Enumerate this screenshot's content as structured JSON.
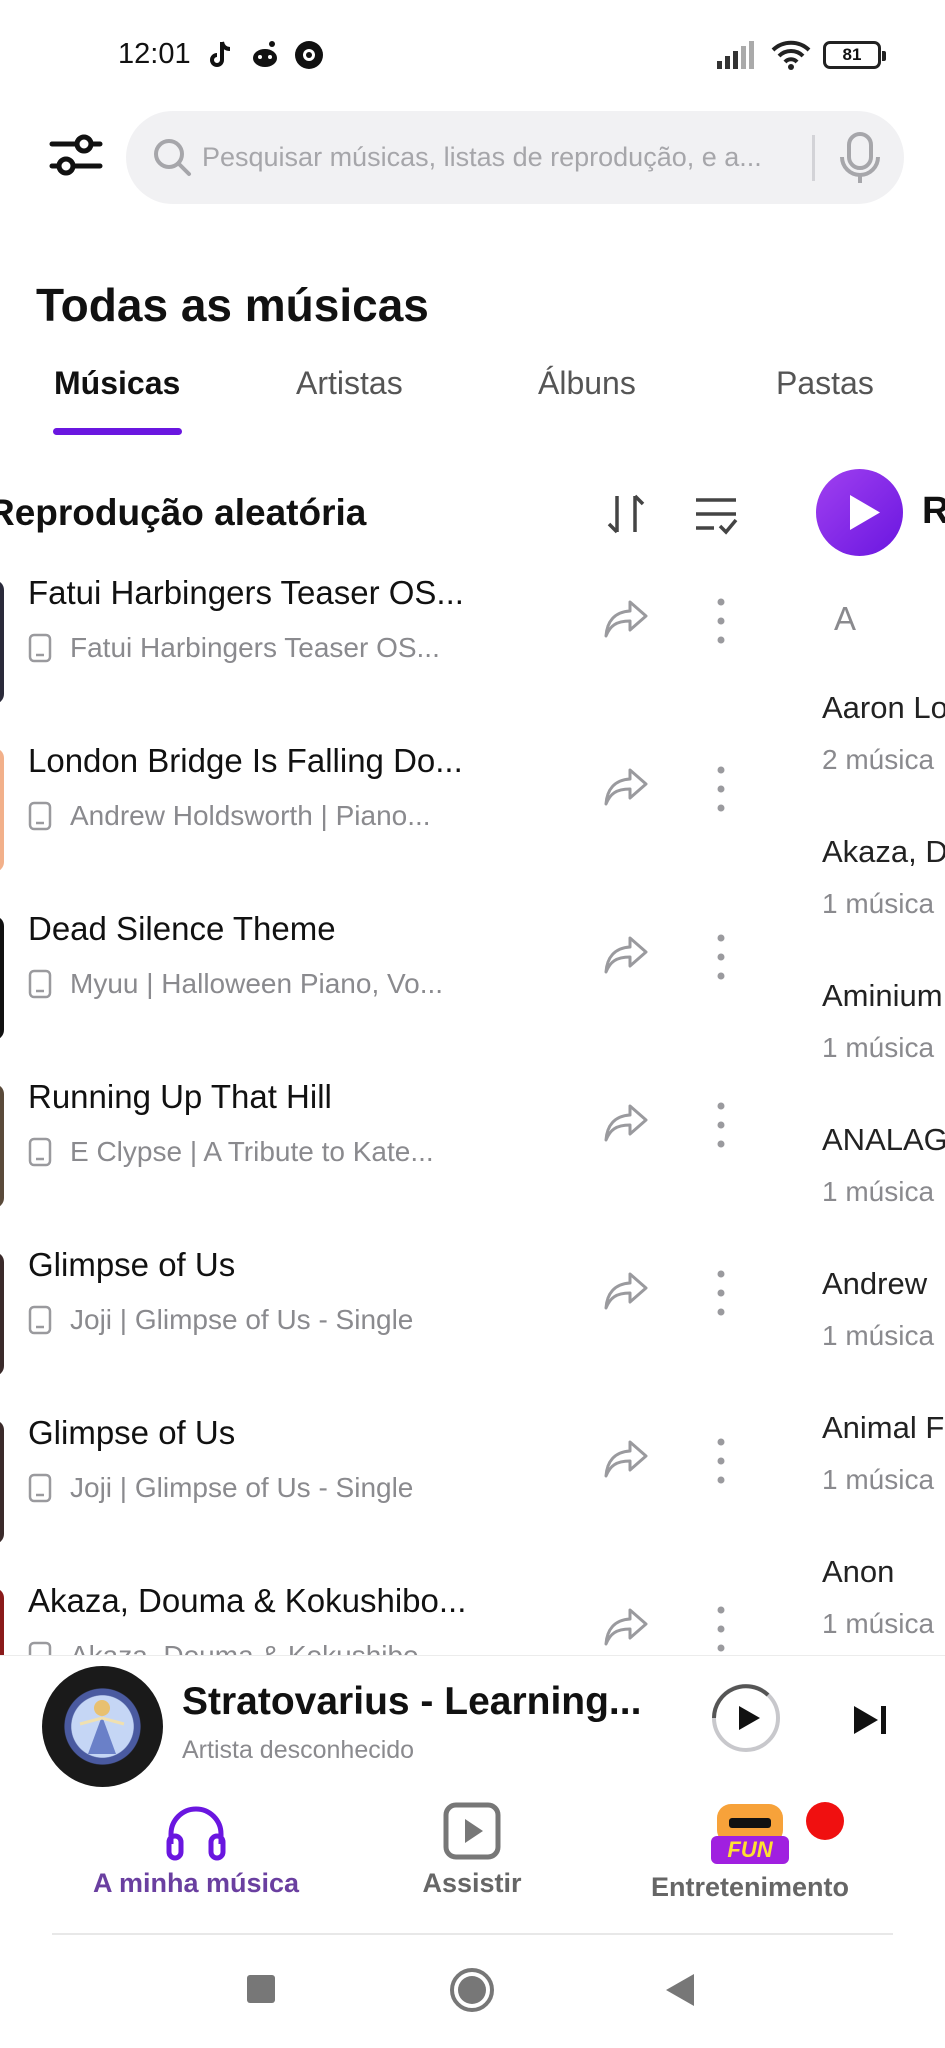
{
  "status_bar": {
    "time": "12:01",
    "battery": "81",
    "left_icons": [
      "tiktok-icon",
      "reddit-icon",
      "record-icon"
    ],
    "right_icons": [
      "signal-icon",
      "wifi-icon",
      "battery-icon"
    ]
  },
  "search": {
    "placeholder": "Pesquisar músicas, listas de reprodução, e a..."
  },
  "page_title": "Todas as músicas",
  "tabs": [
    {
      "label": "Músicas",
      "active": true
    },
    {
      "label": "Artistas",
      "active": false
    },
    {
      "label": "Álbuns",
      "active": false
    },
    {
      "label": "Pastas",
      "active": false
    }
  ],
  "songs_panel": {
    "shuffle_label": "Reprodução aleatória",
    "songs": [
      {
        "title": "Fatui Harbingers Teaser OS...",
        "subtitle": "Fatui Harbingers Teaser OS..."
      },
      {
        "title": "London Bridge Is Falling Do...",
        "subtitle": "Andrew Holdsworth | Piano..."
      },
      {
        "title": "Dead Silence Theme",
        "subtitle": "Myuu | Halloween Piano, Vo..."
      },
      {
        "title": "Running Up That Hill",
        "subtitle": "E Clypse | A Tribute to Kate..."
      },
      {
        "title": "Glimpse of Us",
        "subtitle": "Joji | Glimpse of Us - Single"
      },
      {
        "title": "Glimpse of Us",
        "subtitle": "Joji | Glimpse of Us - Single"
      },
      {
        "title": "Akaza, Douma & Kokushibo...",
        "subtitle": "Akaza, Douma & Kokushibo..."
      }
    ]
  },
  "artists_panel": {
    "play_label": "R",
    "letter": "A",
    "artists": [
      {
        "name": "Aaron Lo",
        "count": "2 música"
      },
      {
        "name": "Akaza, D",
        "count": "1 música"
      },
      {
        "name": "Aminium",
        "count": "1 música"
      },
      {
        "name": "ANALAG",
        "count": "1 música"
      },
      {
        "name": "Andrew",
        "count": "1 música"
      },
      {
        "name": "Animal F",
        "count": "1 música"
      },
      {
        "name": "Anon",
        "count": "1 música"
      }
    ]
  },
  "now_playing": {
    "title": "Stratovarius - Learning...",
    "artist": "Artista desconhecido"
  },
  "bottom_nav": [
    {
      "label": "A minha música",
      "icon": "headphones-icon"
    },
    {
      "label": "Assistir",
      "icon": "video-play-icon"
    },
    {
      "label": "Entretenimento",
      "icon": "fun-icon",
      "badge_text": "FUN"
    }
  ],
  "colors": {
    "accent": "#6a16e0",
    "nav_active": "#6a3fa0",
    "muted": "#8a8a8e"
  }
}
